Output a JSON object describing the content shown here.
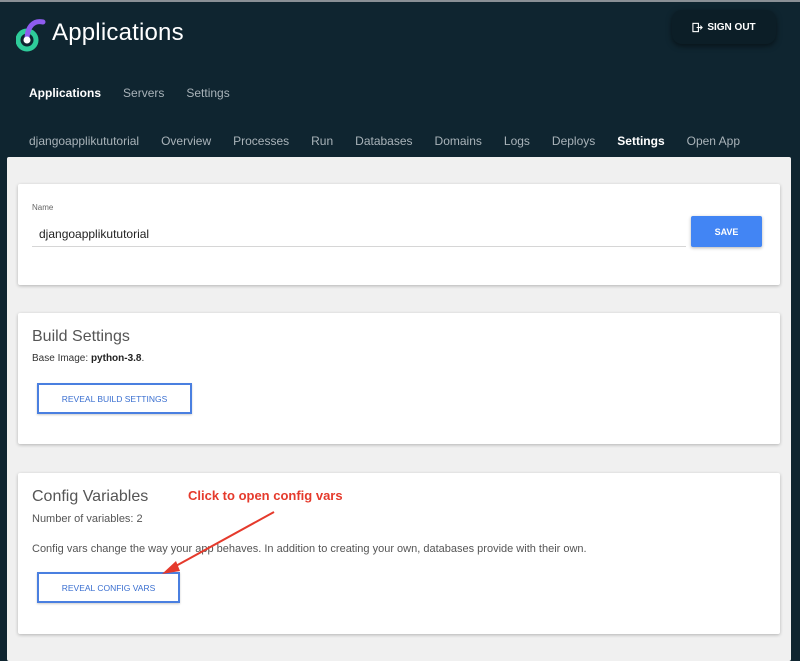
{
  "header": {
    "title": "Applications",
    "logo_icon": "logo-icon",
    "signout_label": "SIGN OUT",
    "signout_icon": "sign-out-icon"
  },
  "main_nav": {
    "items": [
      {
        "label": "Applications",
        "active": true
      },
      {
        "label": "Servers",
        "active": false
      },
      {
        "label": "Settings",
        "active": false
      }
    ]
  },
  "sub_nav": {
    "items": [
      {
        "label": "djangoapplikututorial",
        "active": false
      },
      {
        "label": "Overview",
        "active": false
      },
      {
        "label": "Processes",
        "active": false
      },
      {
        "label": "Run",
        "active": false
      },
      {
        "label": "Databases",
        "active": false
      },
      {
        "label": "Domains",
        "active": false
      },
      {
        "label": "Logs",
        "active": false
      },
      {
        "label": "Deploys",
        "active": false
      },
      {
        "label": "Settings",
        "active": true
      },
      {
        "label": "Open App",
        "active": false
      }
    ]
  },
  "name_card": {
    "label": "Name",
    "value": "djangoapplikututorial",
    "save_label": "SAVE"
  },
  "build_card": {
    "title": "Build Settings",
    "base_image_label": "Base Image:",
    "base_image_value": "python-3.8",
    "base_image_suffix": ".",
    "button_label": "REVEAL BUILD SETTINGS"
  },
  "config_card": {
    "title": "Config Variables",
    "count_text": "Number of variables: 2",
    "description": "Config vars change the way your app behaves. In addition to creating your own, databases provide with their own.",
    "button_label": "REVEAL CONFIG VARS"
  },
  "annotation": {
    "text": "Click to open config vars",
    "color": "#e53a2c"
  },
  "colors": {
    "header_bg": "#0f2530",
    "primary": "#4285f4",
    "content_bg": "#f0f0f0"
  }
}
